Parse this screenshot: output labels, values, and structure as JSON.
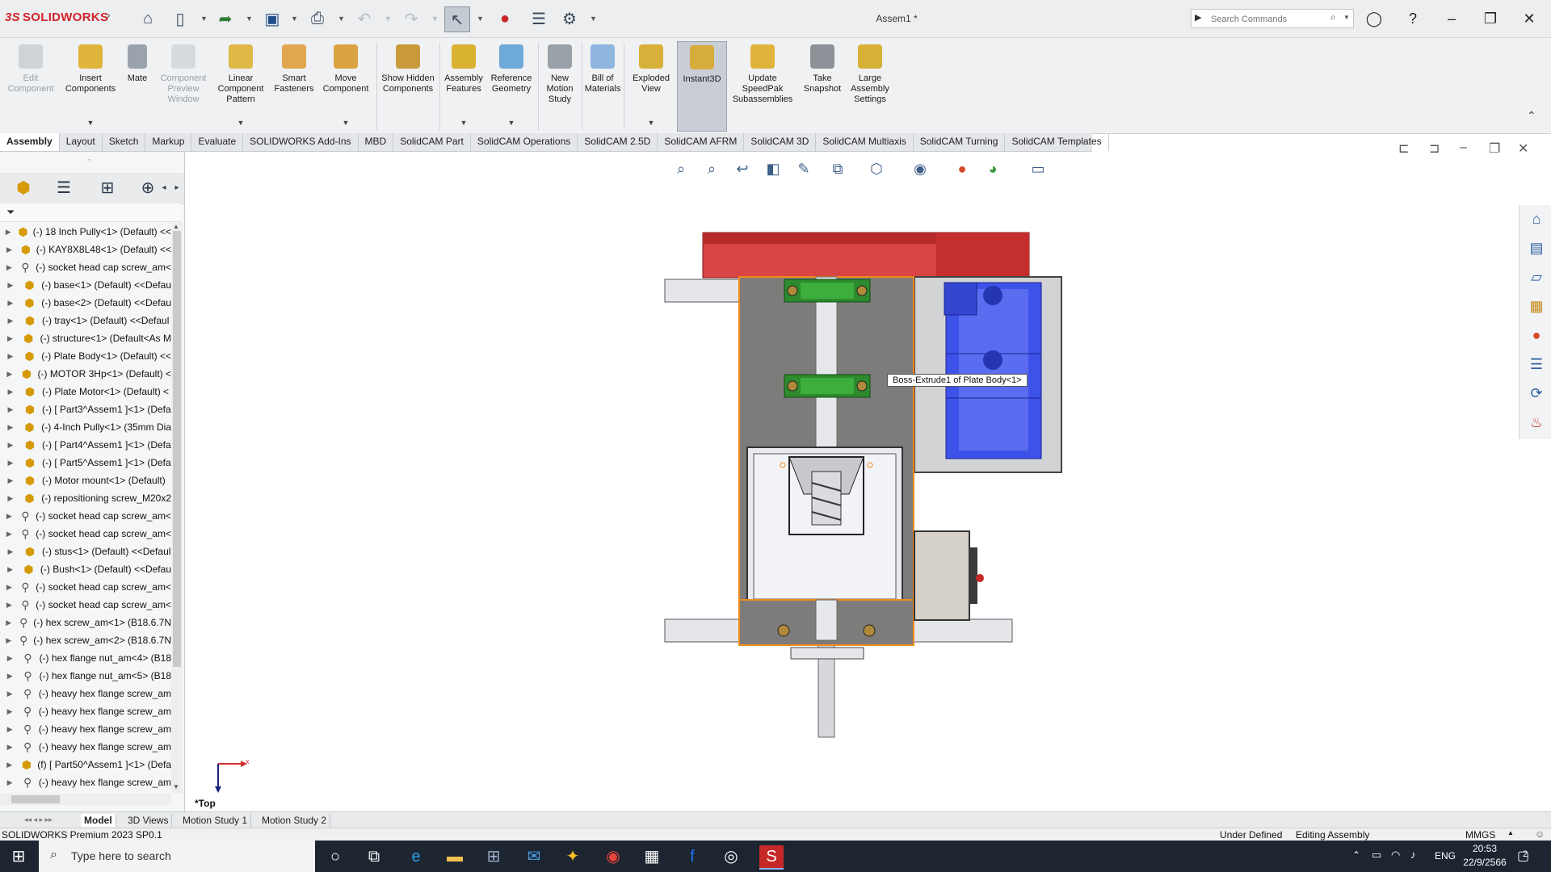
{
  "app": {
    "logo_text": "SOLIDWORKS",
    "document_title": "Assem1 *",
    "search_placeholder": "Search Commands"
  },
  "ribbon": {
    "buttons": [
      {
        "label": "Edit Component",
        "enabled": false
      },
      {
        "label": "Insert Components",
        "enabled": true
      },
      {
        "label": "Mate",
        "enabled": true
      },
      {
        "label": "Component Preview Window",
        "enabled": false
      },
      {
        "label": "Linear Component Pattern",
        "enabled": true
      },
      {
        "label": "Smart Fasteners",
        "enabled": true
      },
      {
        "label": "Move Component",
        "enabled": true
      },
      {
        "label": "Show Hidden Components",
        "enabled": true
      },
      {
        "label": "Assembly Features",
        "enabled": true
      },
      {
        "label": "Reference Geometry",
        "enabled": true
      },
      {
        "label": "New Motion Study",
        "enabled": true
      },
      {
        "label": "Bill of Materials",
        "enabled": true
      },
      {
        "label": "Exploded View",
        "enabled": true
      },
      {
        "label": "Instant3D",
        "enabled": true,
        "active": true
      },
      {
        "label": "Update SpeedPak Subassemblies",
        "enabled": true
      },
      {
        "label": "Take Snapshot",
        "enabled": true
      },
      {
        "label": "Large Assembly Settings",
        "enabled": true
      }
    ]
  },
  "tabs": [
    "Assembly",
    "Layout",
    "Sketch",
    "Markup",
    "Evaluate",
    "SOLIDWORKS Add-Ins",
    "MBD",
    "SolidCAM Part",
    "SolidCAM Operations",
    "SolidCAM 2.5D",
    "SolidCAM AFRM",
    "SolidCAM 3D",
    "SolidCAM Multiaxis",
    "SolidCAM Turning",
    "SolidCAM Templates"
  ],
  "active_tab": "Assembly",
  "tree": {
    "items": [
      {
        "text": "(-) 18 Inch Pully<1> (Default) <<",
        "icon": "assembly"
      },
      {
        "text": "(-) KAY8X8L48<1> (Default) <<",
        "icon": "assembly"
      },
      {
        "text": "(-) socket head cap screw_am<",
        "icon": "screw"
      },
      {
        "text": "(-) base<1> (Default) <<Defau",
        "icon": "assembly"
      },
      {
        "text": "(-) base<2> (Default) <<Defau",
        "icon": "assembly"
      },
      {
        "text": "(-) tray<1> (Default) <<Defaul",
        "icon": "assembly"
      },
      {
        "text": "(-) structure<1> (Default<As M",
        "icon": "assembly"
      },
      {
        "text": "(-) Plate Body<1> (Default) <<",
        "icon": "assembly"
      },
      {
        "text": "(-) MOTOR 3Hp<1> (Default) <",
        "icon": "assembly"
      },
      {
        "text": "(-) Plate Motor<1> (Default) <",
        "icon": "assembly"
      },
      {
        "text": "(-) [ Part3^Assem1 ]<1> (Defa",
        "icon": "assembly"
      },
      {
        "text": "(-) 4-Inch Pully<1> (35mm Dia",
        "icon": "assembly"
      },
      {
        "text": "(-) [ Part4^Assem1 ]<1> (Defa",
        "icon": "assembly"
      },
      {
        "text": "(-) [ Part5^Assem1 ]<1> (Defa",
        "icon": "assembly"
      },
      {
        "text": "(-) Motor mount<1> (Default)",
        "icon": "assembly"
      },
      {
        "text": "(-) repositioning screw_M20x2",
        "icon": "assembly"
      },
      {
        "text": "(-) socket head cap screw_am<",
        "icon": "screw"
      },
      {
        "text": "(-) socket head cap screw_am<",
        "icon": "screw"
      },
      {
        "text": "(-) stus<1> (Default) <<Defaul",
        "icon": "assembly"
      },
      {
        "text": "(-) Bush<1> (Default) <<Defau",
        "icon": "assembly"
      },
      {
        "text": "(-) socket head cap screw_am<",
        "icon": "screw"
      },
      {
        "text": "(-) socket head cap screw_am<",
        "icon": "screw"
      },
      {
        "text": "(-) hex screw_am<1> (B18.6.7N",
        "icon": "screw"
      },
      {
        "text": "(-) hex screw_am<2> (B18.6.7N",
        "icon": "screw"
      },
      {
        "text": "(-) hex flange nut_am<4> (B18",
        "icon": "screw"
      },
      {
        "text": "(-) hex flange nut_am<5> (B18",
        "icon": "screw"
      },
      {
        "text": "(-) heavy hex flange screw_am",
        "icon": "screw"
      },
      {
        "text": "(-) heavy hex flange screw_am",
        "icon": "screw"
      },
      {
        "text": "(-) heavy hex flange screw_am",
        "icon": "screw"
      },
      {
        "text": "(-) heavy hex flange screw_am",
        "icon": "screw"
      },
      {
        "text": "(f) [ Part50^Assem1 ]<1> (Defa",
        "icon": "assembly"
      },
      {
        "text": "(-) heavy hex flange screw_am",
        "icon": "screw"
      }
    ]
  },
  "viewport": {
    "tooltip": "Boss-Extrude1 of Plate Body<1>",
    "view_label": "*Top",
    "triad_x": "x"
  },
  "bottom_tabs": [
    "Model",
    "3D Views",
    "Motion Study 1",
    "Motion Study 2"
  ],
  "active_bottom_tab": "Model",
  "status": {
    "left": "SOLIDWORKS Premium 2023 SP0.1",
    "definition": "Under Defined",
    "mode": "Editing Assembly",
    "units": "MMGS"
  },
  "taskbar": {
    "search_placeholder": "Type here to search",
    "language": "ENG",
    "time": "20:53",
    "date": "22/9/2566",
    "notification_count": "2"
  },
  "colors": {
    "pulley_red": "#d83a3a",
    "motor_blue": "#3b4fe6",
    "plate_gray": "#7d7c7b",
    "bearing_green": "#2d8a2d",
    "selection_orange": "#f08a1c"
  }
}
